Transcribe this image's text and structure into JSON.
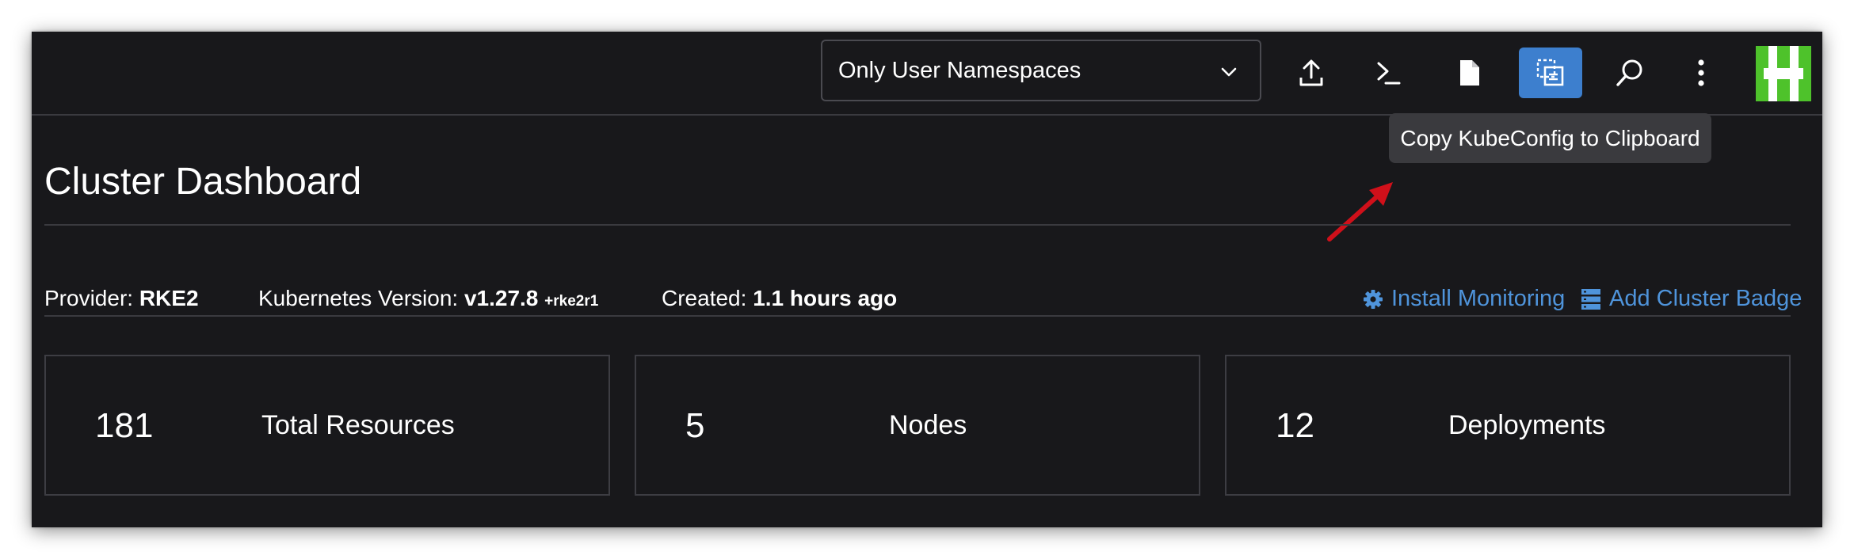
{
  "header": {
    "namespace_filter": "Only User Namespaces",
    "toolbar": [
      {
        "icon": "upload-icon",
        "active": false
      },
      {
        "icon": "terminal-icon",
        "active": false
      },
      {
        "icon": "file-icon",
        "active": false
      },
      {
        "icon": "copy-kubeconfig-icon",
        "active": true
      },
      {
        "icon": "search-icon",
        "active": false
      },
      {
        "icon": "more-vertical-icon",
        "active": false
      }
    ],
    "tooltip": "Copy KubeConfig to Clipboard",
    "accent_color": "#3d7fce",
    "avatar_color": "#4ec22b"
  },
  "page": {
    "title": "Cluster Dashboard",
    "provider_label": "Provider:",
    "provider_value": "RKE2",
    "k8s_label": "Kubernetes Version:",
    "k8s_value": "v1.27.8",
    "k8s_suffix": "+rke2r1",
    "created_label": "Created:",
    "created_value": "1.1 hours ago",
    "install_monitoring": "Install Monitoring",
    "add_cluster_badge": "Add Cluster Badge",
    "link_color": "#4f94db"
  },
  "cards": [
    {
      "count": "181",
      "label": "Total Resources"
    },
    {
      "count": "5",
      "label": "Nodes"
    },
    {
      "count": "12",
      "label": "Deployments"
    }
  ],
  "annotation": {
    "arrow_color": "#d0101a"
  }
}
